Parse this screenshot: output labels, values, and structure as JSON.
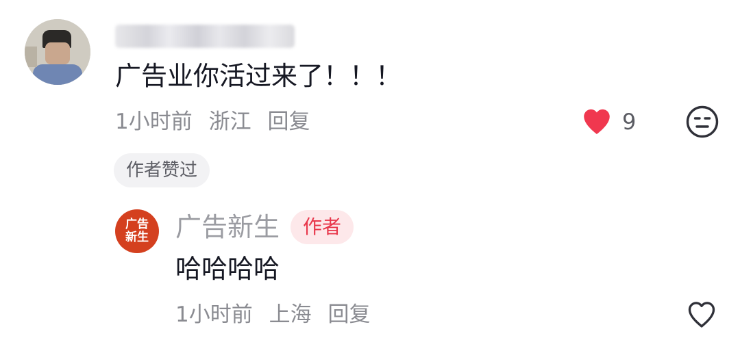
{
  "comment": {
    "text": "广告业你活过来了！！！",
    "time": "1小时前",
    "location": "浙江",
    "reply_label": "回复",
    "like_count": "9",
    "author_liked_label": "作者赞过"
  },
  "reply": {
    "avatar_text_line1": "广告",
    "avatar_text_line2": "新生",
    "author_name": "广告新生",
    "author_badge": "作者",
    "text": "哈哈哈哈",
    "time": "1小时前",
    "location": "上海",
    "reply_label": "回复"
  },
  "icons": {
    "like_filled": "heart-filled-icon",
    "dislike": "neutral-face-icon",
    "like_outline": "heart-outline-icon"
  },
  "colors": {
    "like_red": "#fe2c55",
    "author_badge_text": "#e8364a",
    "author_badge_bg": "#fde8ea",
    "brand_avatar": "#d4401f"
  }
}
